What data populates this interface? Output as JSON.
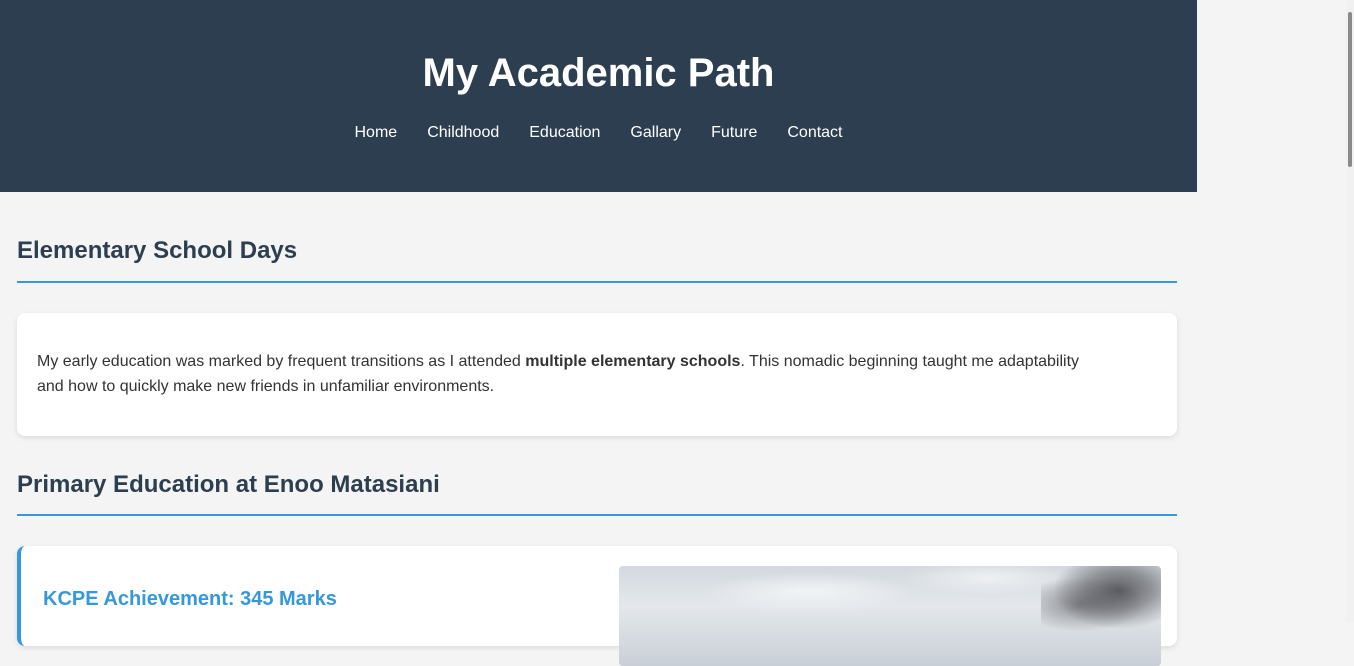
{
  "header": {
    "title": "My Academic Path",
    "nav": [
      "Home",
      "Childhood",
      "Education",
      "Gallary",
      "Future",
      "Contact"
    ]
  },
  "sections": [
    {
      "title": "Elementary School Days",
      "text_before": "My early education was marked by frequent transitions as I attended ",
      "text_bold": "multiple elementary schools",
      "text_after": ". This nomadic beginning taught me adaptability and how to quickly make new friends in unfamiliar environments."
    },
    {
      "title": "Primary Education at Enoo Matasiani",
      "card_heading": "KCPE Achievement: 345 Marks"
    }
  ],
  "colors": {
    "header_bg": "#2c3e50",
    "accent": "#3498db",
    "page_bg": "#f4f4f4"
  }
}
